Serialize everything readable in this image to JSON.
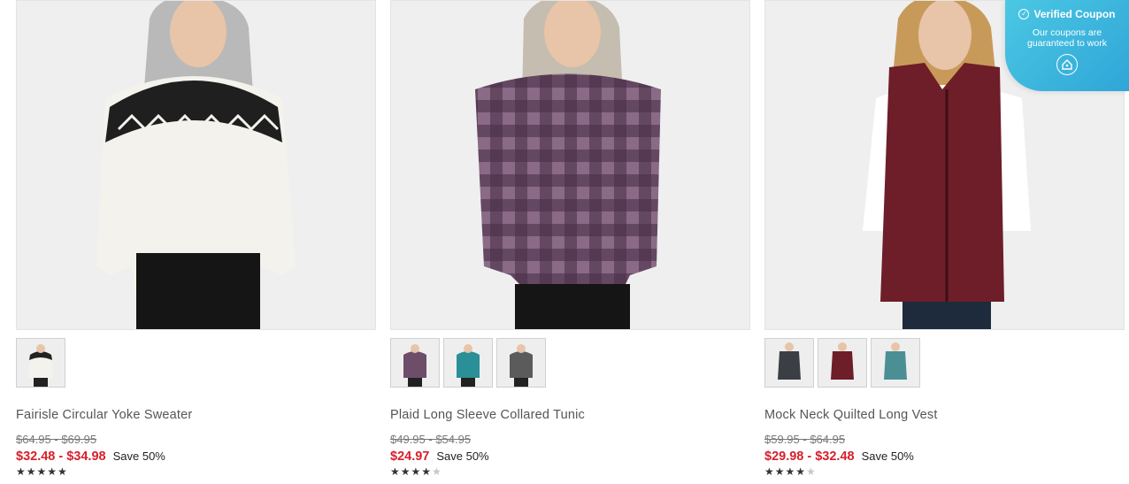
{
  "products": [
    {
      "name": "Fairisle Circular Yoke Sweater",
      "original_price": "$64.95 - $69.95",
      "sale_price": "$32.48 - $34.98",
      "save": "Save 50%",
      "rating": 5,
      "thumbnail_colors": [
        "black-white"
      ]
    },
    {
      "name": "Plaid Long Sleeve Collared Tunic",
      "original_price": "$49.95 - $54.95",
      "sale_price": "$24.97",
      "save": "Save 50%",
      "rating": 4,
      "thumbnail_colors": [
        "plum-plaid",
        "teal-plaid",
        "gray-plaid"
      ]
    },
    {
      "name": "Mock Neck Quilted Long Vest",
      "original_price": "$59.95 - $64.95",
      "sale_price": "$29.98 - $32.48",
      "save": "Save 50%",
      "rating": 4.5,
      "thumbnail_colors": [
        "charcoal",
        "burgundy",
        "teal"
      ]
    }
  ],
  "coupon": {
    "title": "Verified Coupon",
    "text_line1": "Our coupons are",
    "text_line2": "guaranteed to work",
    "icon": "coupon-tag-icon"
  },
  "colors": {
    "sale_red": "#d6202b",
    "coupon_blue": "#3bb6e0"
  }
}
